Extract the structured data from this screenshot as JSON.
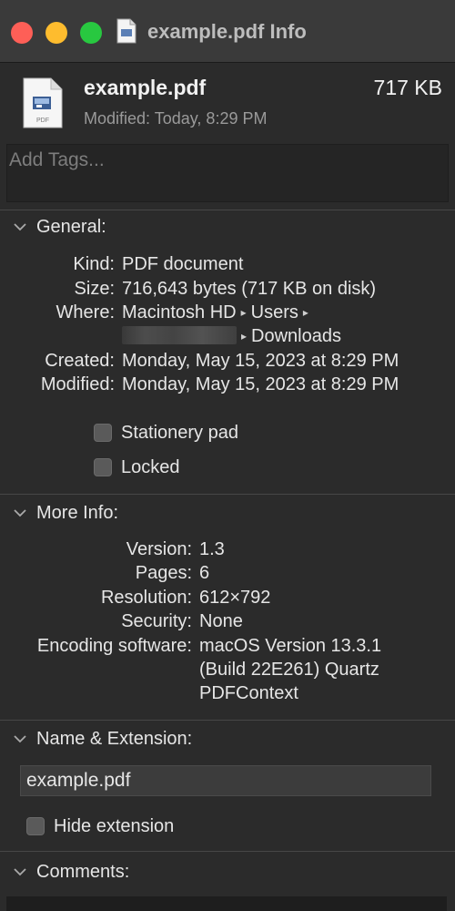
{
  "window": {
    "title": "example.pdf Info"
  },
  "header": {
    "file_name": "example.pdf",
    "size": "717 KB",
    "modified_label": "Modified:",
    "modified_value": "Today, 8:29 PM",
    "icon_label": "PDF"
  },
  "tags": {
    "placeholder": "Add Tags..."
  },
  "general": {
    "title": "General:",
    "kind_label": "Kind:",
    "kind": "PDF document",
    "size_label": "Size:",
    "size": "716,643 bytes (717 KB on disk)",
    "where_label": "Where:",
    "where_path1": "Macintosh HD",
    "where_path2": "Users",
    "where_path3": "Downloads",
    "where_sep": "▸",
    "created_label": "Created:",
    "created": "Monday, May 15, 2023 at 8:29 PM",
    "modified_label": "Modified:",
    "modified": "Monday, May 15, 2023 at 8:29 PM",
    "stationery_label": "Stationery pad",
    "stationery_checked": false,
    "locked_label": "Locked",
    "locked_checked": false
  },
  "more_info": {
    "title": "More Info:",
    "version_label": "Version:",
    "version": "1.3",
    "pages_label": "Pages:",
    "pages": "6",
    "resolution_label": "Resolution:",
    "resolution": "612×792",
    "security_label": "Security:",
    "security": "None",
    "encoding_label": "Encoding software:",
    "encoding_line1": "macOS Version 13.3.1",
    "encoding_line2": "(Build 22E261) Quartz",
    "encoding_line3": "PDFContext"
  },
  "name_extension": {
    "title": "Name & Extension:",
    "value": "example.pdf",
    "hide_extension_label": "Hide extension",
    "hide_extension_checked": false
  },
  "comments": {
    "title": "Comments:"
  },
  "colors": {
    "close": "#fe5f57",
    "minimize": "#febc2e",
    "maximize": "#28c840",
    "background": "#2b2b2b",
    "titlebar": "#3a3a3a"
  }
}
